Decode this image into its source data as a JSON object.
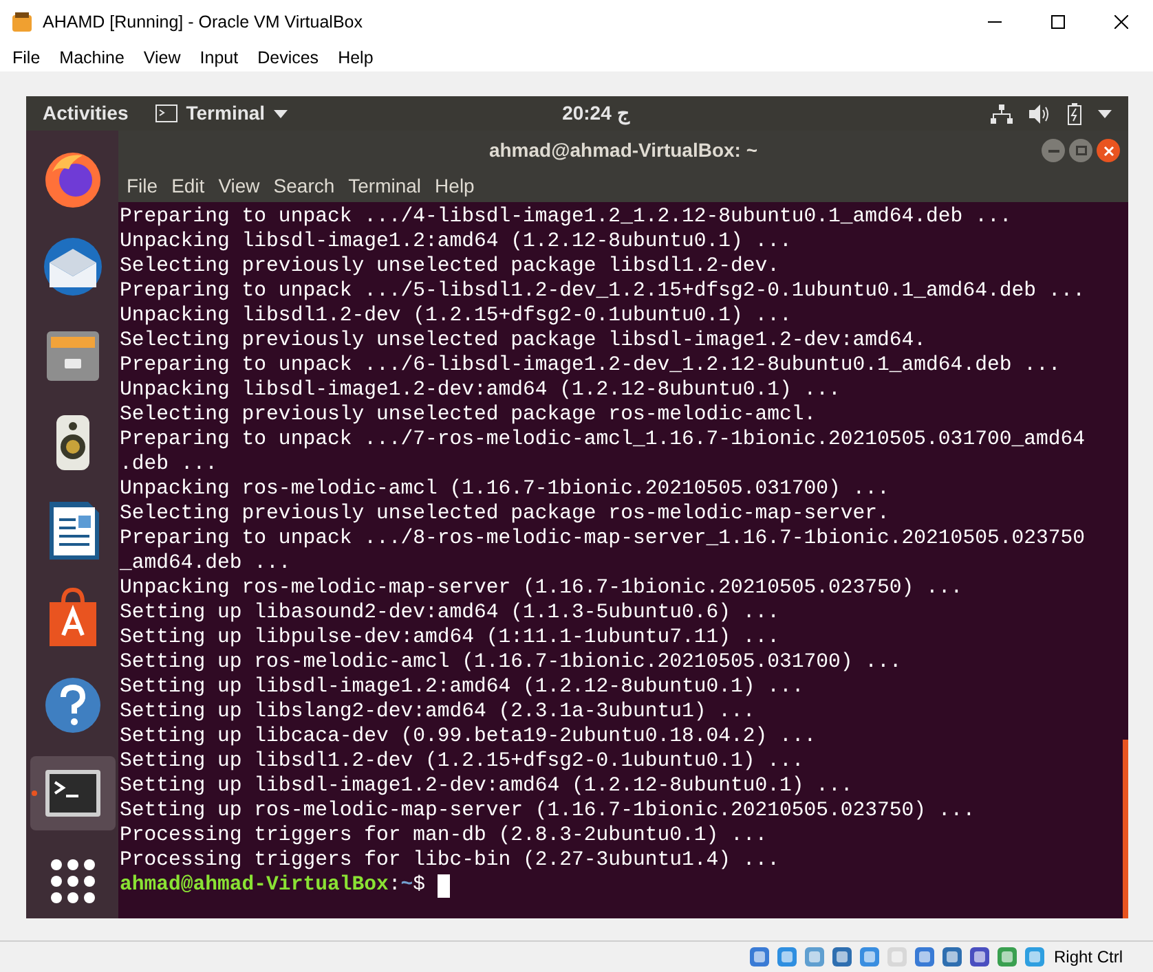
{
  "window": {
    "title": "AHAMD [Running] - Oracle VM VirtualBox"
  },
  "menu": [
    "File",
    "Machine",
    "View",
    "Input",
    "Devices",
    "Help"
  ],
  "top_bar": {
    "activities": "Activities",
    "app": "Terminal",
    "clock": "20:24 ج"
  },
  "dock": [
    {
      "kind": "firefox",
      "selected": false
    },
    {
      "kind": "mail",
      "selected": false
    },
    {
      "kind": "files",
      "selected": false
    },
    {
      "kind": "speaker",
      "selected": false
    },
    {
      "kind": "writer",
      "selected": false
    },
    {
      "kind": "store",
      "selected": false
    },
    {
      "kind": "help",
      "selected": false
    },
    {
      "kind": "terminal",
      "selected": true
    },
    {
      "kind": "apps",
      "selected": false
    }
  ],
  "terminal": {
    "title": "ahmad@ahmad-VirtualBox: ~",
    "menu": [
      "File",
      "Edit",
      "View",
      "Search",
      "Terminal",
      "Help"
    ],
    "lines": [
      "Preparing to unpack .../4-libsdl-image1.2_1.2.12-8ubuntu0.1_amd64.deb ...",
      "Unpacking libsdl-image1.2:amd64 (1.2.12-8ubuntu0.1) ...",
      "Selecting previously unselected package libsdl1.2-dev.",
      "Preparing to unpack .../5-libsdl1.2-dev_1.2.15+dfsg2-0.1ubuntu0.1_amd64.deb ...",
      "Unpacking libsdl1.2-dev (1.2.15+dfsg2-0.1ubuntu0.1) ...",
      "Selecting previously unselected package libsdl-image1.2-dev:amd64.",
      "Preparing to unpack .../6-libsdl-image1.2-dev_1.2.12-8ubuntu0.1_amd64.deb ...",
      "Unpacking libsdl-image1.2-dev:amd64 (1.2.12-8ubuntu0.1) ...",
      "Selecting previously unselected package ros-melodic-amcl.",
      "Preparing to unpack .../7-ros-melodic-amcl_1.16.7-1bionic.20210505.031700_amd64",
      ".deb ...",
      "Unpacking ros-melodic-amcl (1.16.7-1bionic.20210505.031700) ...",
      "Selecting previously unselected package ros-melodic-map-server.",
      "Preparing to unpack .../8-ros-melodic-map-server_1.16.7-1bionic.20210505.023750",
      "_amd64.deb ...",
      "Unpacking ros-melodic-map-server (1.16.7-1bionic.20210505.023750) ...",
      "Setting up libasound2-dev:amd64 (1.1.3-5ubuntu0.6) ...",
      "Setting up libpulse-dev:amd64 (1:11.1-1ubuntu7.11) ...",
      "Setting up ros-melodic-amcl (1.16.7-1bionic.20210505.031700) ...",
      "Setting up libsdl-image1.2:amd64 (1.2.12-8ubuntu0.1) ...",
      "Setting up libslang2-dev:amd64 (2.3.1a-3ubuntu1) ...",
      "Setting up libcaca-dev (0.99.beta19-2ubuntu0.18.04.2) ...",
      "Setting up libsdl1.2-dev (1.2.15+dfsg2-0.1ubuntu0.1) ...",
      "Setting up libsdl-image1.2-dev:amd64 (1.2.12-8ubuntu0.1) ...",
      "Setting up ros-melodic-map-server (1.16.7-1bionic.20210505.023750) ...",
      "Processing triggers for man-db (2.8.3-2ubuntu0.1) ...",
      "Processing triggers for libc-bin (2.27-3ubuntu1.4) ..."
    ],
    "prompt": {
      "user_host": "ahmad@ahmad-VirtualBox",
      "separator": ":",
      "path": "~",
      "symbol": "$"
    }
  },
  "status_bar": {
    "host_key": "Right Ctrl"
  }
}
